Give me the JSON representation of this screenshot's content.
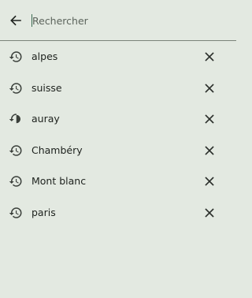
{
  "search": {
    "placeholder": "Rechercher",
    "value": ""
  },
  "icons": {
    "back": "arrow-left-icon",
    "history": "history-icon",
    "remove": "close-icon"
  },
  "colors": {
    "background": "#e3e9e1",
    "caret": "#3b6b52",
    "divider": "#7a837a",
    "text": "#1d211d"
  },
  "history": [
    {
      "label": "alpes"
    },
    {
      "label": "suisse"
    },
    {
      "label": "auray"
    },
    {
      "label": "Chambéry"
    },
    {
      "label": "Mont blanc"
    },
    {
      "label": "paris"
    }
  ]
}
